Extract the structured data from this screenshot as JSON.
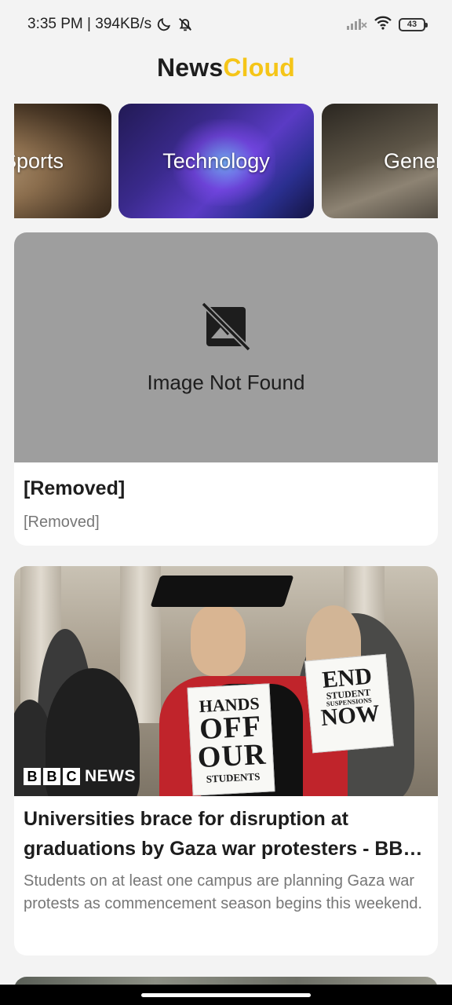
{
  "status_bar": {
    "time_speed": "3:35 PM | 394KB/s",
    "battery_level": "43",
    "icons": [
      "moon-icon",
      "bell-off-icon",
      "signal-icon",
      "wifi-icon",
      "battery-icon"
    ]
  },
  "app": {
    "title_part1": "News",
    "title_part2": "Cloud",
    "accent_color": "#f5c518"
  },
  "categories": [
    {
      "label": "Sports"
    },
    {
      "label": "Technology"
    },
    {
      "label": "General"
    }
  ],
  "articles": [
    {
      "image_status": "Image Not Found",
      "image_icon": "broken-image-icon",
      "title": "[Removed]",
      "description": "[Removed]"
    },
    {
      "image": {
        "sign1": {
          "line1": "HANDS",
          "line2": "OFF",
          "line3": "OUR",
          "line4": "STUDENTS"
        },
        "sign2": {
          "line1": "END",
          "line2": "STUDENT",
          "line3": "SUSPENSIONS",
          "line4": "NOW"
        },
        "watermark": {
          "b1": "B",
          "b2": "B",
          "b3": "C",
          "news": "NEWS"
        }
      },
      "title": "Universities brace for disruption at graduations by Gaza war protesters - BB…",
      "description": "Students on at least one campus are planning Gaza war protests as commencement season begins this weekend."
    }
  ]
}
